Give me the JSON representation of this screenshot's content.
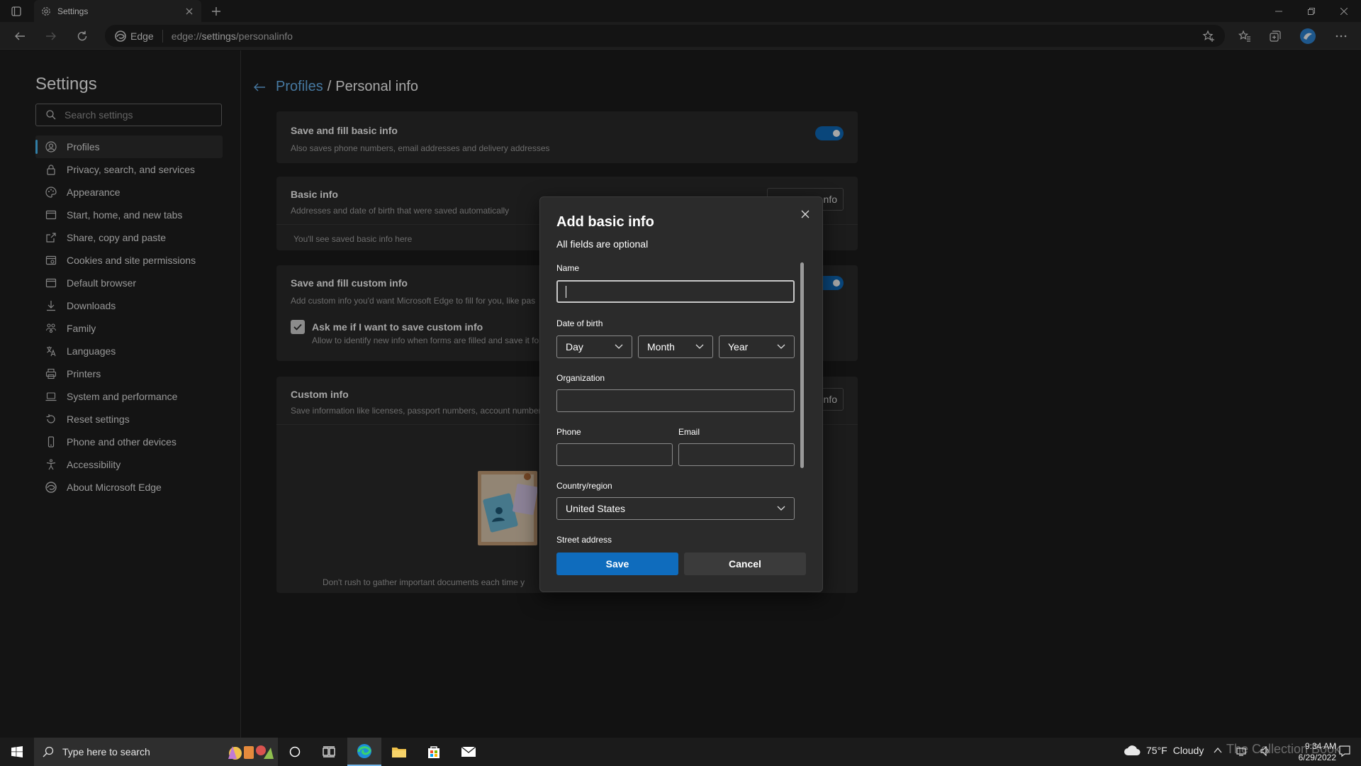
{
  "browser": {
    "tab_title": "Settings",
    "edge_label": "Edge",
    "url_prefix": "edge://",
    "url_strong": "settings",
    "url_suffix": "/personalinfo"
  },
  "sidebar": {
    "title": "Settings",
    "search_placeholder": "Search settings",
    "items": [
      {
        "label": "Profiles",
        "icon": "profile-icon"
      },
      {
        "label": "Privacy, search, and services",
        "icon": "lock-icon"
      },
      {
        "label": "Appearance",
        "icon": "palette-icon"
      },
      {
        "label": "Start, home, and new tabs",
        "icon": "home-tabs-icon"
      },
      {
        "label": "Share, copy and paste",
        "icon": "share-icon"
      },
      {
        "label": "Cookies and site permissions",
        "icon": "cookie-icon"
      },
      {
        "label": "Default browser",
        "icon": "browser-icon"
      },
      {
        "label": "Downloads",
        "icon": "download-icon"
      },
      {
        "label": "Family",
        "icon": "family-icon"
      },
      {
        "label": "Languages",
        "icon": "language-icon"
      },
      {
        "label": "Printers",
        "icon": "printer-icon"
      },
      {
        "label": "System and performance",
        "icon": "laptop-icon"
      },
      {
        "label": "Reset settings",
        "icon": "reset-icon"
      },
      {
        "label": "Phone and other devices",
        "icon": "phone-icon"
      },
      {
        "label": "Accessibility",
        "icon": "accessibility-icon"
      },
      {
        "label": "About Microsoft Edge",
        "icon": "edge-icon"
      }
    ]
  },
  "main": {
    "breadcrumb_link": "Profiles",
    "breadcrumb_sep": "/",
    "breadcrumb_current": "Personal info",
    "card_basic_fill": {
      "title": "Save and fill basic info",
      "desc": "Also saves phone numbers, email addresses and delivery addresses"
    },
    "card_basic_info": {
      "title": "Basic info",
      "desc": "Addresses and date of birth that were saved automatically",
      "button": "nfo",
      "empty": "You'll see saved basic info here"
    },
    "card_custom_fill": {
      "title": "Save and fill custom info",
      "desc": "Add custom info you'd want Microsoft Edge to fill for you, like pas",
      "checkbox_label": "Ask me if I want to save custom info",
      "checkbox_desc": "Allow to identify new info when forms are filled and save it fo"
    },
    "card_custom_info": {
      "title": "Custom info",
      "desc": "Save information like licenses, passport numbers, account number",
      "button": "nfo",
      "footer": "Don't rush to gather important documents each time y"
    }
  },
  "dialog": {
    "title": "Add basic info",
    "subtitle": "All fields are optional",
    "name_label": "Name",
    "name_value": "",
    "dob_label": "Date of birth",
    "day": "Day",
    "month": "Month",
    "year": "Year",
    "org_label": "Organization",
    "phone_label": "Phone",
    "email_label": "Email",
    "country_label": "Country/region",
    "country_value": "United States",
    "street_label": "Street address",
    "save": "Save",
    "cancel": "Cancel"
  },
  "taskbar": {
    "search_placeholder": "Type here to search",
    "weather_temp": "75°F",
    "weather_text": "Cloudy",
    "time": "9:34 AM",
    "date": "6/29/2022",
    "watermark": "The Collection Book"
  },
  "colors": {
    "accent": "#0f6cbd",
    "link": "#6cb8f6"
  }
}
